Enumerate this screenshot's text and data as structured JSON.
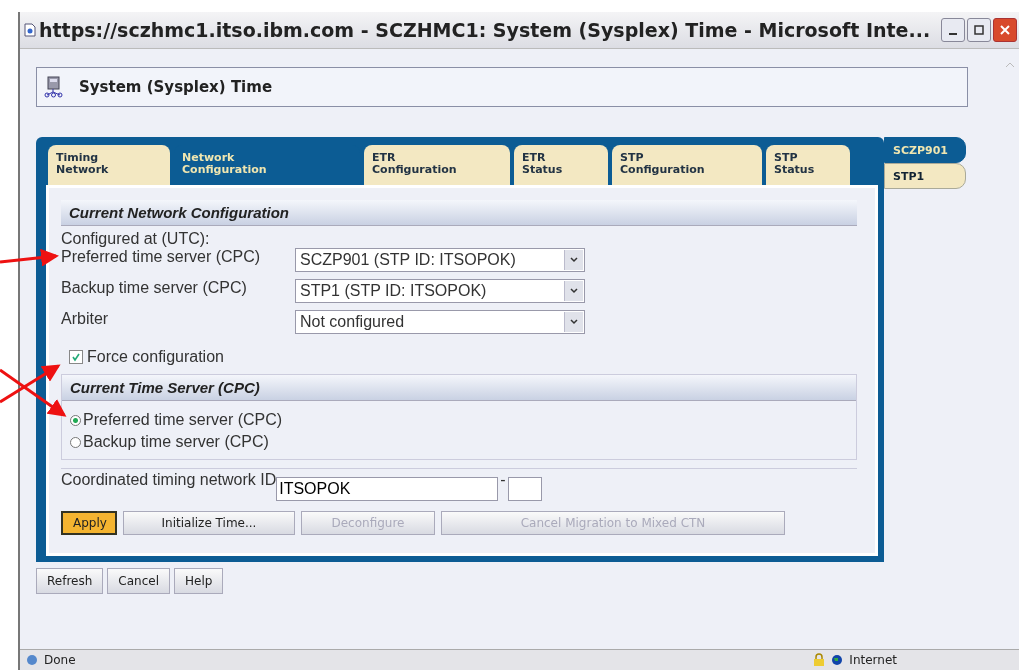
{
  "window": {
    "title": "https://sczhmc1.itso.ibm.com - SCZHMC1: System (Sysplex) Time - Microsoft Inte..."
  },
  "header": {
    "title": "System (Sysplex) Time"
  },
  "tabs": [
    {
      "label": "Timing\nNetwork",
      "selected": false
    },
    {
      "label": "Network\nConfiguration",
      "selected": true
    },
    {
      "label": "ETR\nConfiguration",
      "selected": false
    },
    {
      "label": "ETR\nStatus",
      "selected": false
    },
    {
      "label": "STP\nConfiguration",
      "selected": false
    },
    {
      "label": "STP\nStatus",
      "selected": false
    }
  ],
  "side_tabs": [
    {
      "label": "SCZP901",
      "selected": true
    },
    {
      "label": "STP1",
      "selected": false
    }
  ],
  "network_section": {
    "heading": "Current Network Configuration",
    "configured_at": "Configured at (UTC):",
    "fields": [
      {
        "label": "Preferred time server (CPC)",
        "value": "SCZP901 (STP ID: ITSOPOK)"
      },
      {
        "label": "Backup time server (CPC)",
        "value": "STP1 (STP ID: ITSOPOK)"
      },
      {
        "label": "Arbiter",
        "value": "Not configured"
      }
    ],
    "force": {
      "label": "Force configuration",
      "checked": true
    }
  },
  "time_server_section": {
    "heading": "Current Time Server (CPC)",
    "options": [
      {
        "label": "Preferred time server (CPC)",
        "selected": true
      },
      {
        "label": "Backup time server (CPC)",
        "selected": false
      }
    ]
  },
  "ctn": {
    "label": "Coordinated timing network ID",
    "value": "ITSOPOK",
    "separator": "-"
  },
  "actions": [
    {
      "label": "Apply",
      "primary": true,
      "disabled": false
    },
    {
      "label": "Initialize Time...",
      "primary": false,
      "disabled": false
    },
    {
      "label": "Deconfigure",
      "primary": false,
      "disabled": true
    },
    {
      "label": "Cancel Migration to Mixed CTN",
      "primary": false,
      "disabled": true
    }
  ],
  "footer_buttons": [
    "Refresh",
    "Cancel",
    "Help"
  ],
  "status_bar": {
    "text": "Done",
    "zone": "Internet"
  }
}
